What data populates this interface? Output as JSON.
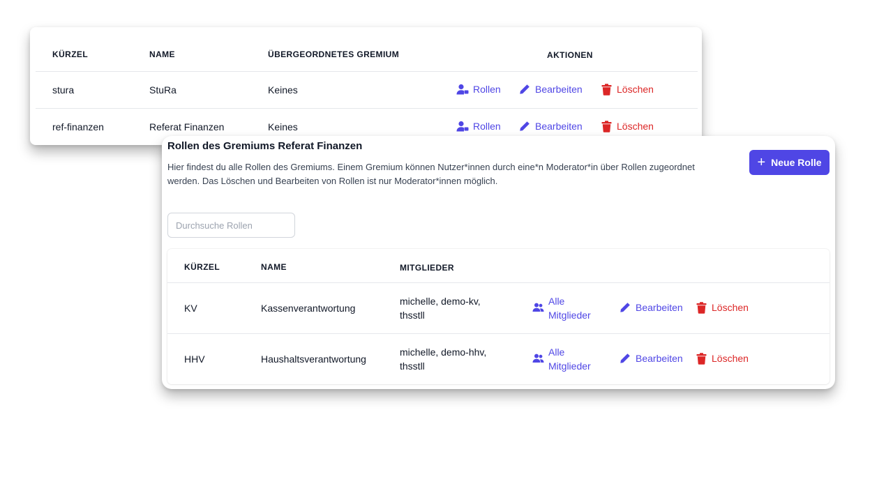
{
  "gremien_table": {
    "headers": {
      "kuerzel": "KÜRZEL",
      "name": "NAME",
      "parent": "ÜBERGEORDNETES GREMIUM",
      "actions": "AKTIONEN"
    },
    "rows": [
      {
        "kuerzel": "stura",
        "name": "StuRa",
        "parent": "Keines",
        "roles_label": "Rollen",
        "edit_label": "Bearbeiten",
        "delete_label": "Löschen"
      },
      {
        "kuerzel": "ref-finanzen",
        "name": "Referat Finanzen",
        "parent": "Keines",
        "roles_label": "Rollen",
        "edit_label": "Bearbeiten",
        "delete_label": "Löschen"
      }
    ]
  },
  "roles_panel": {
    "title": "Rollen des Gremiums Referat Finanzen",
    "description": "Hier findest du alle Rollen des Gremiums. Einem Gremium können Nutzer*innen durch eine*n Moderator*in über Rollen zugeordnet werden. Das Löschen und Bearbeiten von Rollen ist nur Moderator*innen möglich.",
    "new_role_label": "Neue Rolle",
    "search_placeholder": "Durchsuche Rollen",
    "search_value": "",
    "headers": {
      "kuerzel": "KÜRZEL",
      "name": "NAME",
      "members": "MITGLIEDER"
    },
    "rows": [
      {
        "kuerzel": "KV",
        "name": "Kassenverantwortung",
        "members_line1": "michelle, demo-kv,",
        "members_line2": "thsstll",
        "all_line1": "Alle",
        "all_line2": "Mitglieder",
        "edit_label": "Bearbeiten",
        "delete_label": "Löschen"
      },
      {
        "kuerzel": "HHV",
        "name": "Haushaltsverantwortung",
        "members_line1": "michelle, demo-hhv,",
        "members_line2": "thsstll",
        "all_line1": "Alle",
        "all_line2": "Mitglieder",
        "edit_label": "Bearbeiten",
        "delete_label": "Löschen"
      }
    ]
  },
  "colors": {
    "accent": "#4f46e5",
    "danger": "#dc2626",
    "text": "#111827",
    "border": "#e5e7eb"
  },
  "icons": {
    "roles": "user-tag-icon",
    "edit": "pencil-icon",
    "delete": "trash-icon",
    "members": "users-icon",
    "add": "plus-icon"
  }
}
